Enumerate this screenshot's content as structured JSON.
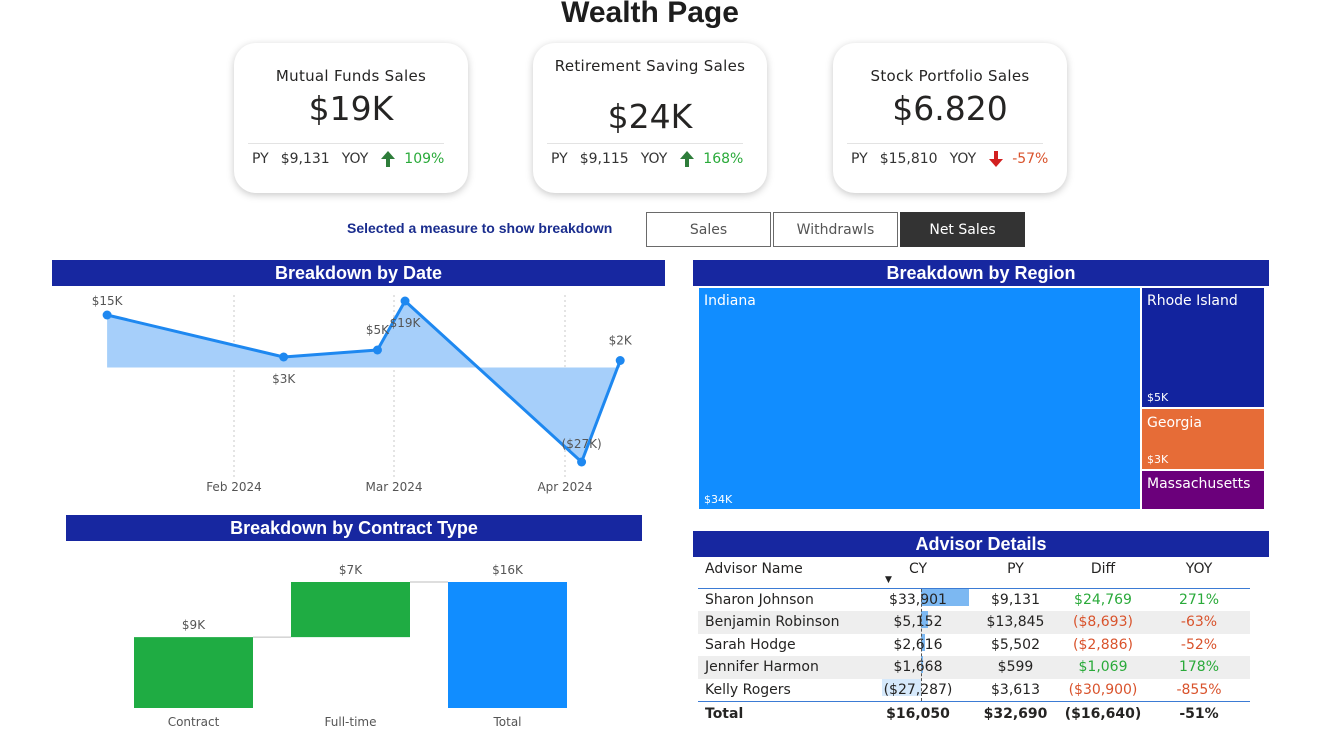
{
  "page": {
    "title": "Wealth Page"
  },
  "kpis": [
    {
      "title": "Mutual Funds Sales",
      "value": "$19K",
      "py_label": "PY",
      "py_value": "$9,131",
      "yoy_label": "YOY",
      "yoy_value": "109%",
      "direction": "up",
      "color": "#2e8b3e"
    },
    {
      "title": "Retirement Saving Sales",
      "value": "$24K",
      "py_label": "PY",
      "py_value": "$9,115",
      "yoy_label": "YOY",
      "yoy_value": "168%",
      "direction": "up",
      "color": "#2e8b3e"
    },
    {
      "title": "Stock Portfolio Sales",
      "value": "$6.820",
      "py_label": "PY",
      "py_value": "$15,810",
      "yoy_label": "YOY",
      "yoy_value": "-57%",
      "direction": "down",
      "color": "#d22020"
    }
  ],
  "measure_selector": {
    "label": "Selected a measure to show breakdown",
    "options": [
      "Sales",
      "Withdrawls",
      "Net Sales"
    ],
    "selected": "Net Sales"
  },
  "colors": {
    "header_bg": "#1727a0",
    "line": "#1e88f0",
    "area": "#a6cffa",
    "bar_green": "#1fac43",
    "bar_blue": "#118dff"
  },
  "date_chart": {
    "title": "Breakdown by Date",
    "chart_data": {
      "type": "area",
      "x": [
        "2024-01-09",
        "2024-02-10",
        "2024-02-27",
        "2024-03-03",
        "2024-04-04",
        "2024-04-11"
      ],
      "values": [
        15,
        3,
        5,
        19,
        -27,
        2
      ],
      "data_labels": [
        "$15K",
        "$3K",
        "$5K",
        "$19K",
        "($27K)",
        "$2K"
      ],
      "x_ticks": [
        "Feb 2024",
        "Mar 2024",
        "Apr 2024"
      ],
      "unit": "thousands USD",
      "grid": "vertical dotted"
    }
  },
  "region_chart": {
    "title": "Breakdown by Region",
    "chart_data": {
      "type": "treemap",
      "categories": [
        "Indiana",
        "Rhode Island",
        "Georgia",
        "Massachusetts"
      ],
      "values": [
        34,
        5,
        3,
        null
      ],
      "data_labels": [
        "$34K",
        "$5K",
        "$3K",
        ""
      ],
      "colors": [
        "#118dff",
        "#12239e",
        "#e66c37",
        "#6b007b"
      ]
    }
  },
  "contract_chart": {
    "title": "Breakdown by Contract Type",
    "chart_data": {
      "type": "bar",
      "subtype": "waterfall",
      "categories": [
        "Contract",
        "Full-time",
        "Total"
      ],
      "values": [
        9,
        7,
        16
      ],
      "data_labels": [
        "$9K",
        "$7K",
        "$16K"
      ],
      "colors": [
        "#1fac43",
        "#1fac43",
        "#118dff"
      ]
    }
  },
  "advisor_table": {
    "title": "Advisor Details",
    "columns": [
      "Advisor Name",
      "CY",
      "PY",
      "Diff",
      "YOY"
    ],
    "sort_column": "CY",
    "rows": [
      {
        "name": "Sharon Johnson",
        "cy": "$33,901",
        "cy_value": 33901,
        "py": "$9,131",
        "diff": "$24,769",
        "yoy": "271%",
        "positive": true
      },
      {
        "name": "Benjamin Robinson",
        "cy": "$5,152",
        "cy_value": 5152,
        "py": "$13,845",
        "diff": "($8,693)",
        "yoy": "-63%",
        "positive": false
      },
      {
        "name": "Sarah Hodge",
        "cy": "$2,616",
        "cy_value": 2616,
        "py": "$5,502",
        "diff": "($2,886)",
        "yoy": "-52%",
        "positive": false
      },
      {
        "name": "Jennifer Harmon",
        "cy": "$1,668",
        "cy_value": 1668,
        "py": "$599",
        "diff": "$1,069",
        "yoy": "178%",
        "positive": true
      },
      {
        "name": "Kelly Rogers",
        "cy": "($27,287)",
        "cy_value": -27287,
        "py": "$3,613",
        "diff": "($30,900)",
        "yoy": "-855%",
        "positive": false
      }
    ],
    "total": {
      "label": "Total",
      "cy": "$16,050",
      "py": "$32,690",
      "diff": "($16,640)",
      "yoy": "-51%"
    }
  }
}
